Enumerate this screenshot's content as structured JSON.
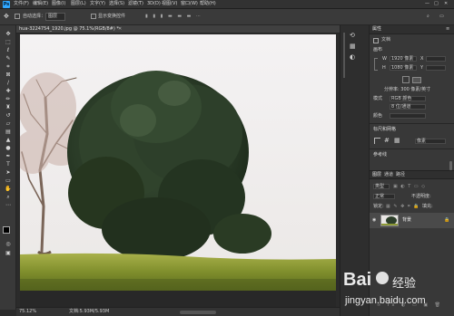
{
  "menubar": {
    "items": [
      "文件(F)",
      "编辑(E)",
      "图像(I)",
      "图层(L)",
      "文字(Y)",
      "选择(S)",
      "滤镜(T)",
      "3D(D)",
      "视图(V)",
      "窗口(W)",
      "帮助(H)"
    ]
  },
  "options": {
    "auto_select": "自动选择：",
    "group_select": "图层",
    "show_transform": "显示变换控件"
  },
  "document": {
    "tab_title": "hua-3224754_1920.jpg @ 75.1%(RGB/8#) *",
    "zoom": "75.12%",
    "doc_info": "文档:5.93M/5.93M"
  },
  "properties": {
    "tab": "属性",
    "type_label": "文档",
    "canvas_section": "画布",
    "w_label": "W",
    "w_value": "1920 像素",
    "h_label": "H",
    "h_value": "1080 像素",
    "x_label": "X",
    "y_label": "Y",
    "resolution": "分辨率: 300 像素/英寸",
    "mode_label": "模式",
    "mode_value": "RGB 颜色",
    "depth_value": "8 位/通道",
    "bg_label": "颜色",
    "rulers_section": "标尺和网格",
    "grid_unit": "像素",
    "guides_section": "参考线"
  },
  "layers": {
    "tabs": [
      "图层",
      "通道",
      "路径"
    ],
    "filter_label": "类型",
    "blend_mode": "正常",
    "opacity_label": "不透明度:",
    "lock_label": "锁定:",
    "fill_label": "填充:",
    "layer_name": "背景"
  },
  "watermark": {
    "brand": "Bai",
    "brand2": "经验",
    "url": "jingyan.baidu.com"
  }
}
